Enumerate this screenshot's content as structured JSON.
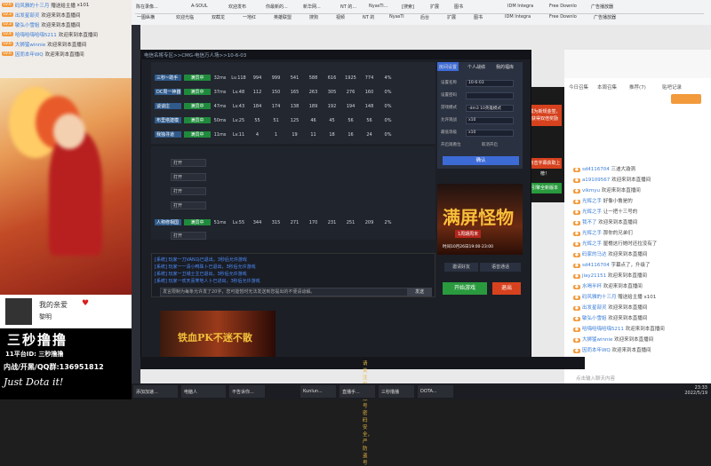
{
  "left_chat": [
    {
      "lv": "LV.6",
      "name": "码风雅的十三月",
      "msg": "赠送给主播",
      "extra": "x101"
    },
    {
      "lv": "LV.3",
      "name": "出发星部灵",
      "msg": "欢迎来到本直播间"
    },
    {
      "lv": "LV.3",
      "name": "敏弘小雪姐",
      "msg": "欢迎来到本直播间"
    },
    {
      "lv": "LV.4",
      "name": "哈嗨哈嗨哈嗨5211",
      "msg": "欢迎来到本直播间"
    },
    {
      "lv": "LV.6",
      "name": "大狮猛winnie",
      "msg": "欢迎来到本直播间"
    },
    {
      "lv": "LV.6",
      "name": "因而本年WQ",
      "msg": "欢迎来到本直播间"
    }
  ],
  "streamer": {
    "line1": "我的亲爱",
    "line2": "黎明"
  },
  "brand": {
    "title": "三秒撸撸",
    "id": "11平台ID: 三秒撸撸",
    "qq": "内战/开黑/QQ群:136951812",
    "slogan": "Just Dota it!"
  },
  "browser": {
    "tabs": [
      "陈在录像...",
      "A-SOUL",
      "欢迎发布",
      "你最新的...",
      "新华网...",
      "NT 的...",
      "NyasTi...",
      "[搜索]",
      "扩展",
      "图书",
      "IDM Integra",
      "Free Downlo",
      "广告播放器"
    ],
    "bookmarks": [
      "一图纵横",
      "欢迎光临",
      "双截龙",
      "一地红",
      "英雄联盟",
      "搜狗",
      "视频",
      "NT 的",
      "NyasTi",
      "后台",
      "扩展",
      "图书",
      "IDM Integra",
      "Free Downlo",
      "广告播放器"
    ]
  },
  "dota": {
    "title": "电信名将专区>>CMG-电信万人场>>10-6-03",
    "rooms": [
      {
        "name": "三秒~助手",
        "btn": "满员中",
        "stats": [
          "32ms",
          "Lv.118",
          "994",
          "999",
          "541",
          "588",
          "616",
          "1925",
          "774",
          "4%"
        ]
      },
      {
        "name": "DC周一神器",
        "btn": "满员中",
        "stats": [
          "37ms",
          "Lv.48",
          "112",
          "150",
          "165",
          "263",
          "305",
          "276",
          "160",
          "0%"
        ]
      },
      {
        "name": "谈谈庄",
        "btn": "满员中",
        "stats": [
          "47ms",
          "Lv.43",
          "184",
          "174",
          "138",
          "189",
          "192",
          "194",
          "148",
          "0%"
        ]
      },
      {
        "name": "布里塔建模",
        "btn": "满员中",
        "stats": [
          "50ms",
          "Lv.25",
          "55",
          "51",
          "125",
          "46",
          "45",
          "56",
          "56",
          "0%"
        ]
      },
      {
        "name": "我独寻道",
        "btn": "满员中",
        "stats": [
          "11ms",
          "Lv.11",
          "4",
          "1",
          "19",
          "11",
          "18",
          "16",
          "24",
          "0%"
        ]
      }
    ],
    "slots": [
      "打开",
      "打开",
      "打开",
      "打开",
      "打开"
    ],
    "extra_room": {
      "name": "人称修相国",
      "btn": "满员中",
      "stats": [
        "51ms",
        "Lv.55",
        "344",
        "315",
        "271",
        "170",
        "231",
        "251",
        "209",
        "2%"
      ]
    },
    "logs": [
      "[系统] 玩家一刀VAN马已退出，3秒后允许游戏",
      "[系统] 玩家一一清小鸭珠卜已退出，3秒后允许游戏",
      "[系统] 玩家一卫城士主已退出，3秒后允许游戏",
      "[系统] 玩家一欢天喜笑地人卜已进出，3秒后允许游戏"
    ],
    "chat_placeholder": "发言限制为每条允许发了20字，您可能暂时无法发送到您提出的不便请谅解。",
    "send": "发送",
    "settings": {
      "tabs": [
        "房间设置",
        "个人战绩",
        "我的福库"
      ],
      "rows": [
        {
          "label": "设置名称",
          "value": "10-6-03"
        },
        {
          "label": "设置密码",
          "value": ""
        },
        {
          "label": "游戏模式",
          "value": "-dm3 10英雄模式"
        },
        {
          "label": "允许观战",
          "value": "x10"
        },
        {
          "label": "最低等级",
          "value": "x10"
        },
        {
          "label": "开启观看位",
          "value": "取消开启"
        }
      ],
      "confirm": "确认"
    },
    "poster": {
      "title": "满屏怪物",
      "sub": "1周期周末",
      "date": "时间10月26日19:00-23:00"
    },
    "invite": "邀请好友",
    "voice": "语音通话",
    "start": "开始游戏",
    "exit": "退出",
    "banner": "铁血PK不迷不散",
    "footer": "请关注您的账号密码安全，严防盗号"
  },
  "right": {
    "tabs": [
      "今日召集",
      "本周召集",
      "推荐(7)",
      "贴吧记录"
    ],
    "chat": [
      {
        "name": "sd4116704",
        "msg": "三迪大漩涡"
      },
      {
        "name": "a19109567",
        "msg": "欢迎来到本直播间"
      },
      {
        "name": "vikmyu",
        "msg": "欢迎来到本直播间"
      },
      {
        "name": "光辉之手",
        "msg": "好像小鲁是的"
      },
      {
        "name": "光辉之手",
        "msg": "让一把十三号的"
      },
      {
        "name": "我不了",
        "msg": "欢迎来到本直播间"
      },
      {
        "name": "光辉之手",
        "msg": "那你的兄弟们"
      },
      {
        "name": "光辉之手",
        "msg": "屋檐这行她时还拉没有了"
      },
      {
        "name": "码家的马达",
        "msg": "欢迎来到本直播间"
      },
      {
        "name": "sd4116704",
        "msg": "字幕点了，升级了"
      },
      {
        "name": "jiay21151",
        "msg": "欢迎来到本直播间"
      },
      {
        "name": "水喝半杯",
        "msg": "欢迎来到本直播间"
      },
      {
        "name": "码风雅的十三月",
        "msg": "赠送给主播",
        "extra": "x101"
      },
      {
        "name": "出发星部灵",
        "msg": "欢迎来到本直播间"
      },
      {
        "name": "敏弘小雪姐",
        "msg": "欢迎来到本直播间"
      },
      {
        "name": "哈嗨哈嗨哈嗨5211",
        "msg": "欢迎来到本直播间"
      },
      {
        "name": "大狮猛winnie",
        "msg": "欢迎来到本直播间"
      },
      {
        "name": "因而本年WQ",
        "msg": "欢迎来到本直播间"
      }
    ],
    "input": "点击输入聊天内容"
  },
  "popup": {
    "buttons": [
      "成为新规金签，获得双倍奖励",
      "点击字幕获取上榜！",
      "引擎全新版本"
    ]
  },
  "taskbar": {
    "items": [
      "添加加速...",
      "电脑人",
      "",
      " 不告诉你...",
      "",
      "Kunlun...",
      "直播手...",
      "三秒撸播",
      "DOTA...",
      ""
    ],
    "time": "23:33",
    "date": "2022/5/19"
  }
}
